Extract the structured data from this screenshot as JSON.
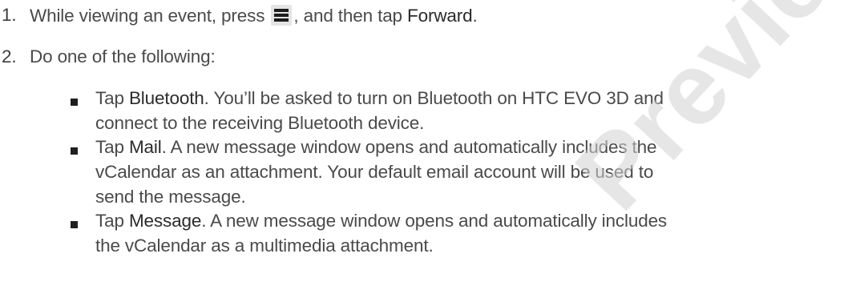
{
  "steps": [
    {
      "number": "1.",
      "text_before": "While viewing an event, press ",
      "icon": "menu-icon",
      "text_mid": ", and then tap ",
      "bold": "Forward",
      "text_after": "."
    },
    {
      "number": "2.",
      "text": "Do one of the following:"
    }
  ],
  "options": [
    {
      "prefix": "Tap ",
      "bold": "Bluetooth",
      "lines": [
        ". You’ll be asked to turn on Bluetooth on HTC EVO 3D and",
        "connect to the receiving Bluetooth device."
      ]
    },
    {
      "prefix": "Tap ",
      "bold": "Mail",
      "lines": [
        ". A new message window opens and automatically includes the",
        "vCalendar as an attachment. Your default email account will be used to",
        "send the message."
      ]
    },
    {
      "prefix": "Tap ",
      "bold": "Message",
      "lines": [
        ". A new message window opens and automatically includes",
        "the vCalendar as a multimedia attachment."
      ]
    }
  ],
  "watermark": "Preview"
}
